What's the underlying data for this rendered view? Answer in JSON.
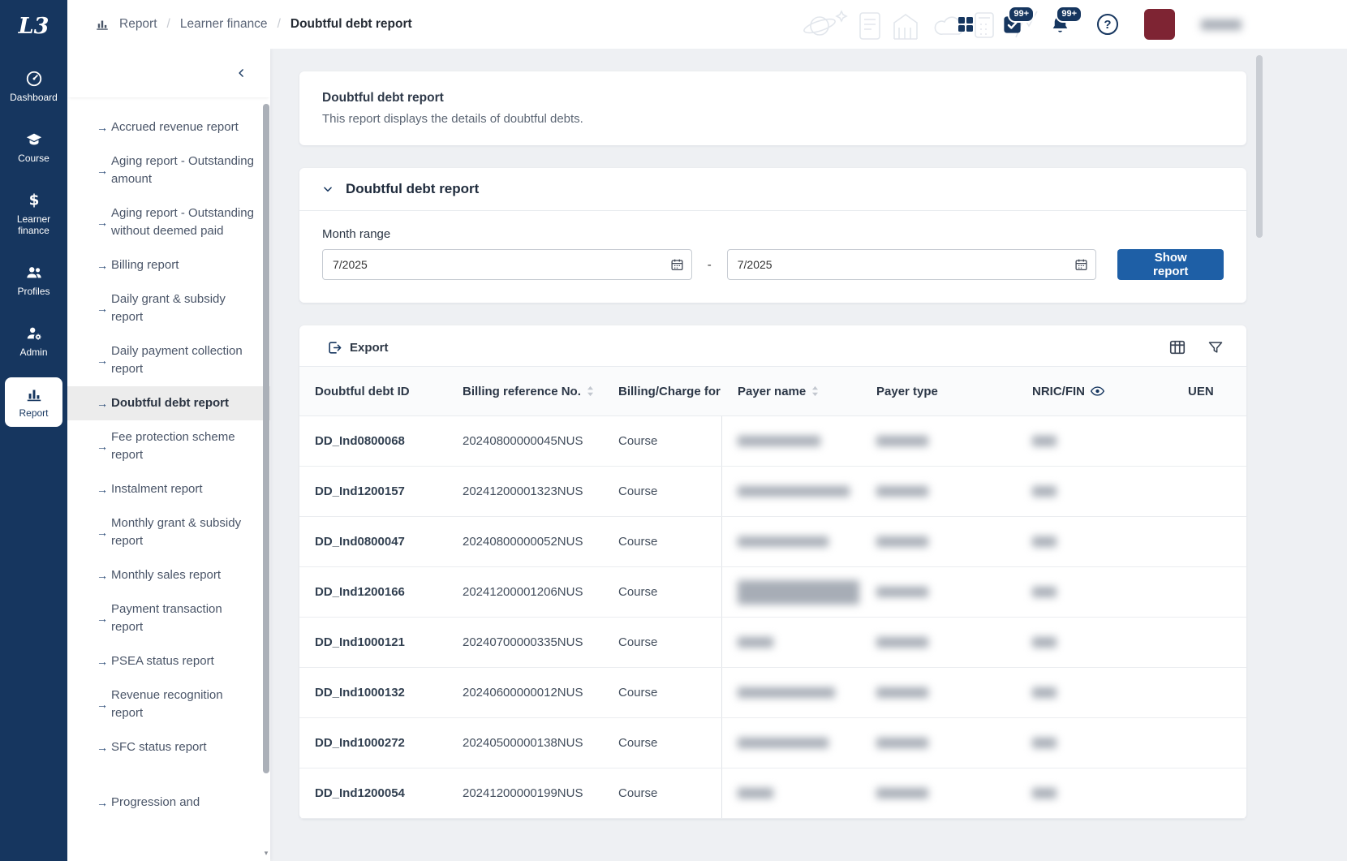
{
  "colors": {
    "sidebar": "#16365F",
    "accent": "#1E5FA6",
    "active_nav_bg": "#ECECEC",
    "avatar": "#7E2433"
  },
  "icons": {
    "arrow_right": "→",
    "help": "?",
    "scroll_down": "▾"
  },
  "logo": {
    "text": "L3"
  },
  "primary_sidebar": {
    "items": [
      {
        "key": "dashboard",
        "label": "Dashboard",
        "icon": "dashboard-icon",
        "active": false
      },
      {
        "key": "course",
        "label": "Course",
        "icon": "course-icon",
        "active": false
      },
      {
        "key": "learner-finance",
        "label": "Learner finance",
        "icon": "learner-finance-icon",
        "active": false
      },
      {
        "key": "profiles",
        "label": "Profiles",
        "icon": "profiles-icon",
        "active": false
      },
      {
        "key": "admin",
        "label": "Admin",
        "icon": "admin-icon",
        "active": false
      },
      {
        "key": "report",
        "label": "Report",
        "icon": "report-icon",
        "active": true
      }
    ]
  },
  "topbar": {
    "breadcrumb": {
      "separator": "/",
      "items": [
        "Report",
        "Learner finance",
        "Doubtful debt report"
      ]
    },
    "badges": {
      "tasks": "99+",
      "notifications": "99+"
    }
  },
  "report_nav": {
    "active_item": "Doubtful debt report",
    "items": [
      "Accrued revenue report",
      "Aging report - Outstanding amount",
      "Aging report - Outstanding without deemed paid",
      "Billing report",
      "Daily grant & subsidy report",
      "Daily payment collection report",
      "Doubtful debt report",
      "Fee protection scheme report",
      "Instalment report",
      "Monthly grant & subsidy report",
      "Monthly sales report",
      "Payment transaction report",
      "PSEA status report",
      "Revenue recognition report",
      "SFC status report",
      "Progression and"
    ]
  },
  "info_card": {
    "title": "Doubtful debt report",
    "description": "This report displays the details of doubtful debts."
  },
  "filter_card": {
    "title": "Doubtful debt report",
    "month_range_label": "Month range",
    "from_value": "7/2025",
    "to_value": "7/2025",
    "range_separator": "-",
    "show_report_label": "Show report"
  },
  "table_card": {
    "export_label": "Export",
    "columns": [
      {
        "label": "Doubtful debt ID",
        "sortable": false,
        "masked": false
      },
      {
        "label": "Billing reference No.",
        "sortable": true,
        "masked": false
      },
      {
        "label": "Billing/Charge for",
        "sortable": false,
        "masked": false
      },
      {
        "label": "Payer name",
        "sortable": true,
        "masked": false
      },
      {
        "label": "Payer type",
        "sortable": false,
        "masked": false
      },
      {
        "label": "NRIC/FIN",
        "sortable": false,
        "masked": true
      },
      {
        "label": "UEN",
        "sortable": false,
        "masked": false
      }
    ],
    "rows": [
      {
        "doubtful_debt_id": "DD_Ind0800068",
        "billing_reference_no": "20240800000045NUS",
        "billing_charge_for": "Course"
      },
      {
        "doubtful_debt_id": "DD_Ind1200157",
        "billing_reference_no": "20241200001323NUS",
        "billing_charge_for": "Course"
      },
      {
        "doubtful_debt_id": "DD_Ind0800047",
        "billing_reference_no": "20240800000052NUS",
        "billing_charge_for": "Course"
      },
      {
        "doubtful_debt_id": "DD_Ind1200166",
        "billing_reference_no": "20241200001206NUS",
        "billing_charge_for": "Course"
      },
      {
        "doubtful_debt_id": "DD_Ind1000121",
        "billing_reference_no": "20240700000335NUS",
        "billing_charge_for": "Course"
      },
      {
        "doubtful_debt_id": "DD_Ind1000132",
        "billing_reference_no": "20240600000012NUS",
        "billing_charge_for": "Course"
      },
      {
        "doubtful_debt_id": "DD_Ind1000272",
        "billing_reference_no": "20240500000138NUS",
        "billing_charge_for": "Course"
      },
      {
        "doubtful_debt_id": "DD_Ind1200054",
        "billing_reference_no": "20241200000199NUS",
        "billing_charge_for": "Course"
      }
    ]
  }
}
